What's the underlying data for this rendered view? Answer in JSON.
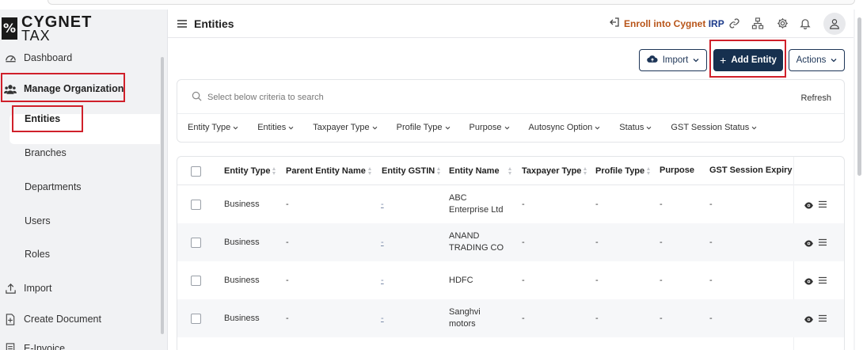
{
  "brand": {
    "line1": "CYGNET",
    "line2": "TAX",
    "mark": "%"
  },
  "sidebar": {
    "items": [
      {
        "label": "Dashboard"
      },
      {
        "label": "Manage Organization"
      },
      {
        "label": "Entities"
      },
      {
        "label": "Branches"
      },
      {
        "label": "Departments"
      },
      {
        "label": "Users"
      },
      {
        "label": "Roles"
      },
      {
        "label": "Import"
      },
      {
        "label": "Create Document"
      },
      {
        "label": "E-Invoice"
      }
    ]
  },
  "header": {
    "title": "Entities",
    "enroll_prefix": "Enroll into Cygnet",
    "enroll_suffix": "IRP"
  },
  "toolbar": {
    "import_label": "Import",
    "add_label": "Add Entity",
    "actions_label": "Actions"
  },
  "search": {
    "placeholder": "Select below criteria to search",
    "refresh_label": "Refresh",
    "filters": [
      "Entity Type",
      "Entities",
      "Taxpayer Type",
      "Profile Type",
      "Purpose",
      "Autosync Option",
      "Status",
      "GST Session Status"
    ]
  },
  "table": {
    "columns": [
      "Entity Type",
      "Parent Entity Name",
      "Entity GSTIN",
      "Entity Name",
      "Taxpayer Type",
      "Profile Type",
      "Purpose",
      "GST Session Expiry"
    ],
    "rows": [
      {
        "entity_type": "Business",
        "parent": "-",
        "gstin": "-",
        "name1": "ABC",
        "name2": "Enterprise Ltd",
        "taxpayer": "-",
        "profile": "-",
        "purpose": "-",
        "expiry": "-"
      },
      {
        "entity_type": "Business",
        "parent": "-",
        "gstin": "-",
        "name1": "ANAND",
        "name2": "TRADING CO",
        "taxpayer": "-",
        "profile": "-",
        "purpose": "-",
        "expiry": "-"
      },
      {
        "entity_type": "Business",
        "parent": "-",
        "gstin": "-",
        "name1": "HDFC",
        "name2": "",
        "taxpayer": "-",
        "profile": "-",
        "purpose": "-",
        "expiry": "-"
      },
      {
        "entity_type": "Business",
        "parent": "-",
        "gstin": "-",
        "name1": "Sanghvi",
        "name2": "motors",
        "taxpayer": "-",
        "profile": "-",
        "purpose": "-",
        "expiry": "-"
      }
    ]
  },
  "colors": {
    "primary": "#16304f",
    "highlight": "#d0202a",
    "enroll": "#b85418",
    "irp": "#1b3a8a"
  }
}
